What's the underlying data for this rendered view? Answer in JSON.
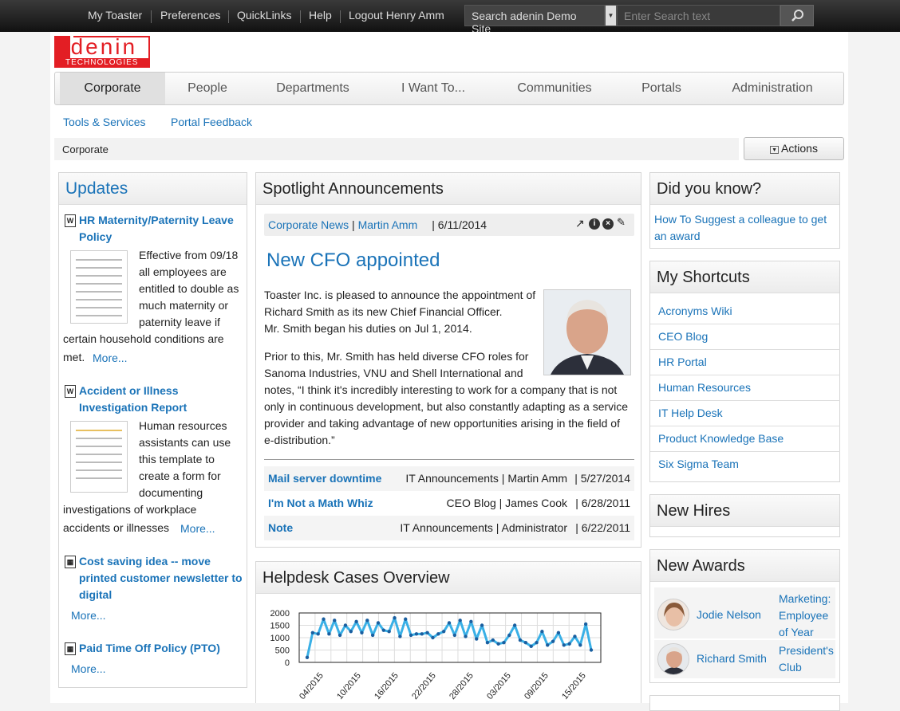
{
  "topnav": {
    "items": [
      "My Toaster",
      "Preferences",
      "QuickLinks",
      "Help",
      "Logout Henry Amm"
    ],
    "search_scope": "Search adenin Demo Site",
    "search_placeholder": "Enter Search text"
  },
  "logo": {
    "top": "adenin",
    "bottom": "TECHNOLOGIES"
  },
  "tabs": [
    "Corporate",
    "People",
    "Departments",
    "I Want To...",
    "Communities",
    "Portals",
    "Administration"
  ],
  "subnav": [
    "Tools & Services",
    "Portal Feedback"
  ],
  "breadcrumb": "Corporate",
  "actions_label": "Actions",
  "updates": {
    "title": "Updates",
    "items": [
      {
        "title_1": "HR Maternity/Paternity Leave",
        "title_2": "Policy",
        "lines": [
          "Effective from 09/18",
          "all employees are",
          "entitled to double as",
          "much maternity or",
          "paternity leave if",
          "certain household conditions are",
          "met."
        ],
        "more": "More..."
      },
      {
        "title_1": "Accident or Illness",
        "title_2": "Investigation Report",
        "lines": [
          "Human resources",
          "assistants can use",
          "this template to",
          "create a form for",
          "documenting",
          "investigations of workplace",
          "accidents or illnesses"
        ],
        "more": "More..."
      },
      {
        "title_1": "Cost saving idea -- move",
        "title_2": "printed customer newsletter to",
        "title_3": "digital",
        "more": "More..."
      },
      {
        "title_1": "Paid Time Off Policy (PTO)",
        "more": "More..."
      }
    ]
  },
  "spotlight": {
    "title": "Spotlight Announcements",
    "meta_source": "Corporate News",
    "meta_author": "Martin Amm",
    "meta_date": "| 6/11/2014",
    "headline": "New CFO appointed",
    "para1": [
      "Toaster Inc. is pleased to announce the appointment of",
      "Richard Smith as its new Chief Financial Officer.",
      "Mr. Smith began his duties on Jul 1, 2014."
    ],
    "para2": [
      "Prior to this, Mr. Smith has held diverse CFO roles for",
      "Sanoma Industries, VNU and Shell International and",
      "notes, “I think it's incredibly interesting to work for a company that is not",
      "only in continuous development, but also constantly adapting as a service",
      "provider and taking advantage of new opportunities arising in the field of",
      "e-distribution.”"
    ],
    "rows": [
      {
        "title": "Mail server downtime",
        "source": "IT Announcements | Martin Amm",
        "date": "| 5/27/2014"
      },
      {
        "title": "I'm Not a Math Whiz",
        "source": "CEO Blog | James Cook",
        "date": "| 6/28/2011"
      },
      {
        "title": "Note",
        "source": "IT Announcements | Administrator",
        "date": "| 6/22/2011"
      }
    ]
  },
  "helpdesk": {
    "title": "Helpdesk Cases Overview"
  },
  "chart_data": {
    "type": "line",
    "title": "",
    "xlabel": "",
    "ylabel": "",
    "ylim": [
      0,
      2000
    ],
    "yticks": [
      0,
      500,
      1000,
      1500,
      2000
    ],
    "x_tick_labels": [
      "04/2015",
      "10/2015",
      "16/2015",
      "22/2015",
      "28/2015",
      "03/2015",
      "09/2015",
      "15/2015"
    ],
    "series": [
      {
        "values": [
          200,
          1200,
          1150,
          1750,
          1150,
          1700,
          1100,
          1500,
          1250,
          1650,
          1200,
          1700,
          1100,
          1600,
          1300,
          1250,
          1800,
          1050,
          1750,
          1100,
          1150,
          1150,
          1200,
          1000,
          1150,
          1250,
          1600,
          1100,
          1700,
          1050,
          1650,
          950,
          1500,
          800,
          900,
          750,
          800,
          1100,
          1500,
          900,
          800,
          650,
          800,
          1250,
          700,
          850,
          1200,
          700,
          750,
          1050,
          700,
          1550,
          500
        ]
      }
    ]
  },
  "didyouknow": {
    "title": "Did you know?",
    "link_1": "How To Suggest a colleague to get",
    "link_2": "an award"
  },
  "shortcuts": {
    "title": "My Shortcuts",
    "items": [
      "Acronyms Wiki",
      "CEO Blog",
      "HR Portal",
      "Human Resources",
      "IT Help Desk",
      "Product Knowledge Base",
      "Six Sigma Team"
    ]
  },
  "newhires": {
    "title": "New Hires"
  },
  "awards": {
    "title": "New Awards",
    "items": [
      {
        "name": "Jodie Nelson",
        "award": [
          "Marketing:",
          "Employee",
          "of Year"
        ]
      },
      {
        "name": "Richard Smith",
        "award": [
          "President's",
          "Club"
        ]
      }
    ]
  }
}
